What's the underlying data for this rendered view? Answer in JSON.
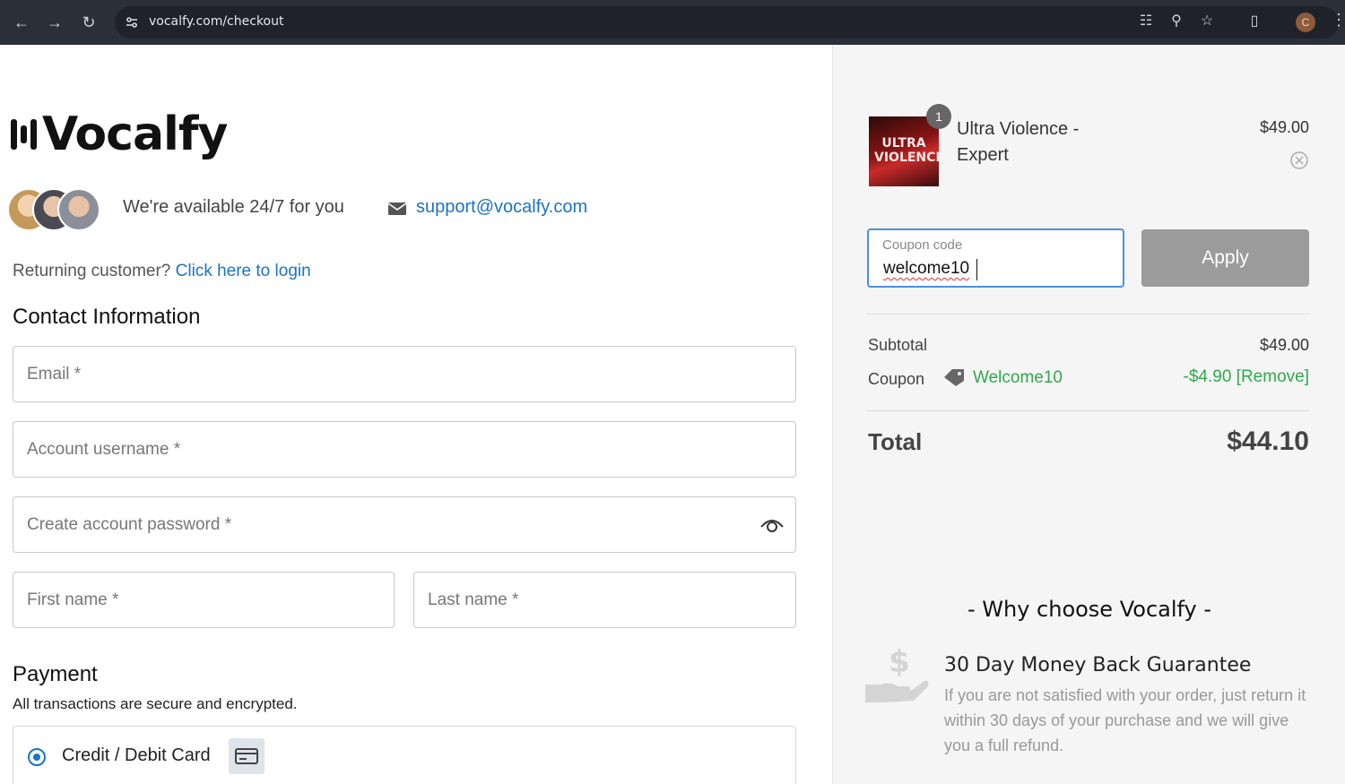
{
  "browser": {
    "url": "vocalfy.com/checkout",
    "profile_initial": "C",
    "icons": [
      "back-icon",
      "forward-icon",
      "reload-icon",
      "site-settings-icon",
      "translate-icon",
      "zoom-icon",
      "bookmark-star-icon",
      "extensions-icon",
      "menu-icon"
    ]
  },
  "brand": {
    "name": "Vocalfy"
  },
  "support": {
    "availability": "We're available 24/7 for you",
    "email": "support@vocalfy.com"
  },
  "returning": {
    "prefix": "Returning customer?",
    "link": "Click here to login"
  },
  "contact": {
    "heading": "Contact Information",
    "email_placeholder": "Email *",
    "username_placeholder": "Account username *",
    "password_placeholder": "Create account password *",
    "first_name_placeholder": "First name *",
    "last_name_placeholder": "Last name *"
  },
  "payment": {
    "heading": "Payment",
    "subtitle": "All transactions are secure and encrypted.",
    "method_label": "Credit / Debit Card",
    "selected": true
  },
  "cart": {
    "item": {
      "quantity": "1",
      "thumb_text_line1": "ULTRA",
      "thumb_text_line2": "VIOLENCE",
      "name_line1": "Ultra Violence -",
      "name_line2": "Expert",
      "price": "$49.00"
    },
    "coupon": {
      "label": "Coupon code",
      "value": "welcome10",
      "apply_label": "Apply"
    },
    "subtotal_label": "Subtotal",
    "subtotal_value": "$49.00",
    "coupon_label": "Coupon",
    "coupon_name": "Welcome10",
    "coupon_discount": "-$4.90 [Remove]",
    "total_label": "Total",
    "total_value": "$44.10"
  },
  "why": {
    "heading": "- Why choose Vocalfy -",
    "guarantee_title": "30 Day Money Back Guarantee",
    "guarantee_body": "If you are not satisfied with your order, just return it within 30 days of your purchase and we will give you a full refund."
  },
  "colors": {
    "link": "#1a73c8",
    "success": "#2eaa4e",
    "apply_button": "#9b9b9b",
    "focus_border": "#4a90e2"
  }
}
